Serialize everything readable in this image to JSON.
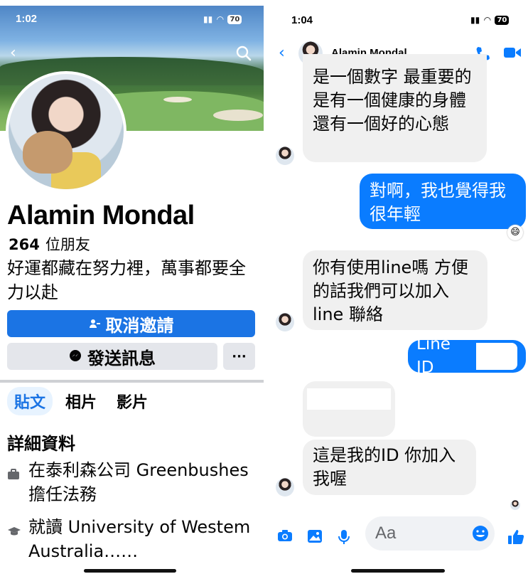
{
  "left": {
    "status": {
      "time": "1:02",
      "battery": "70"
    },
    "profile": {
      "name": "Alamin Mondal",
      "friends_count": "264",
      "friends_label": "位朋友",
      "bio": "好運都藏在努力裡，萬事都要全力以赴"
    },
    "buttons": {
      "cancel_label": "取消邀請",
      "message_label": "發送訊息",
      "more_label": "···"
    },
    "tabs": [
      "貼文",
      "相片",
      "影片"
    ],
    "details": {
      "heading": "詳細資料",
      "work": "在泰利森公司 Greenbushes 擔任法務",
      "school": "就讀 University of Westem Australia……"
    }
  },
  "right": {
    "status": {
      "time": "1:04",
      "battery": "70"
    },
    "header": {
      "name": "Alamin Mondal"
    },
    "messages": [
      {
        "direction": "in",
        "text": "是一個數字 最重要的是有一個健康的身體還有一個好的心態"
      },
      {
        "direction": "out",
        "text": "對啊，我也覺得我很年輕"
      },
      {
        "direction": "in",
        "text": "你有使用line嗎 方便的話我們可以加入 line 聯絡"
      },
      {
        "direction": "out",
        "text": "Line ID"
      },
      {
        "direction": "in",
        "text": "這是我的ID 你加入我喔"
      }
    ],
    "reaction": "😄",
    "composer": {
      "placeholder": "Aa"
    }
  },
  "colors": {
    "facebook_blue": "#1b74e4",
    "messenger_blue": "#0a7cff",
    "bubble_gray": "#f0f0f0",
    "button_gray": "#e4e6eb"
  }
}
